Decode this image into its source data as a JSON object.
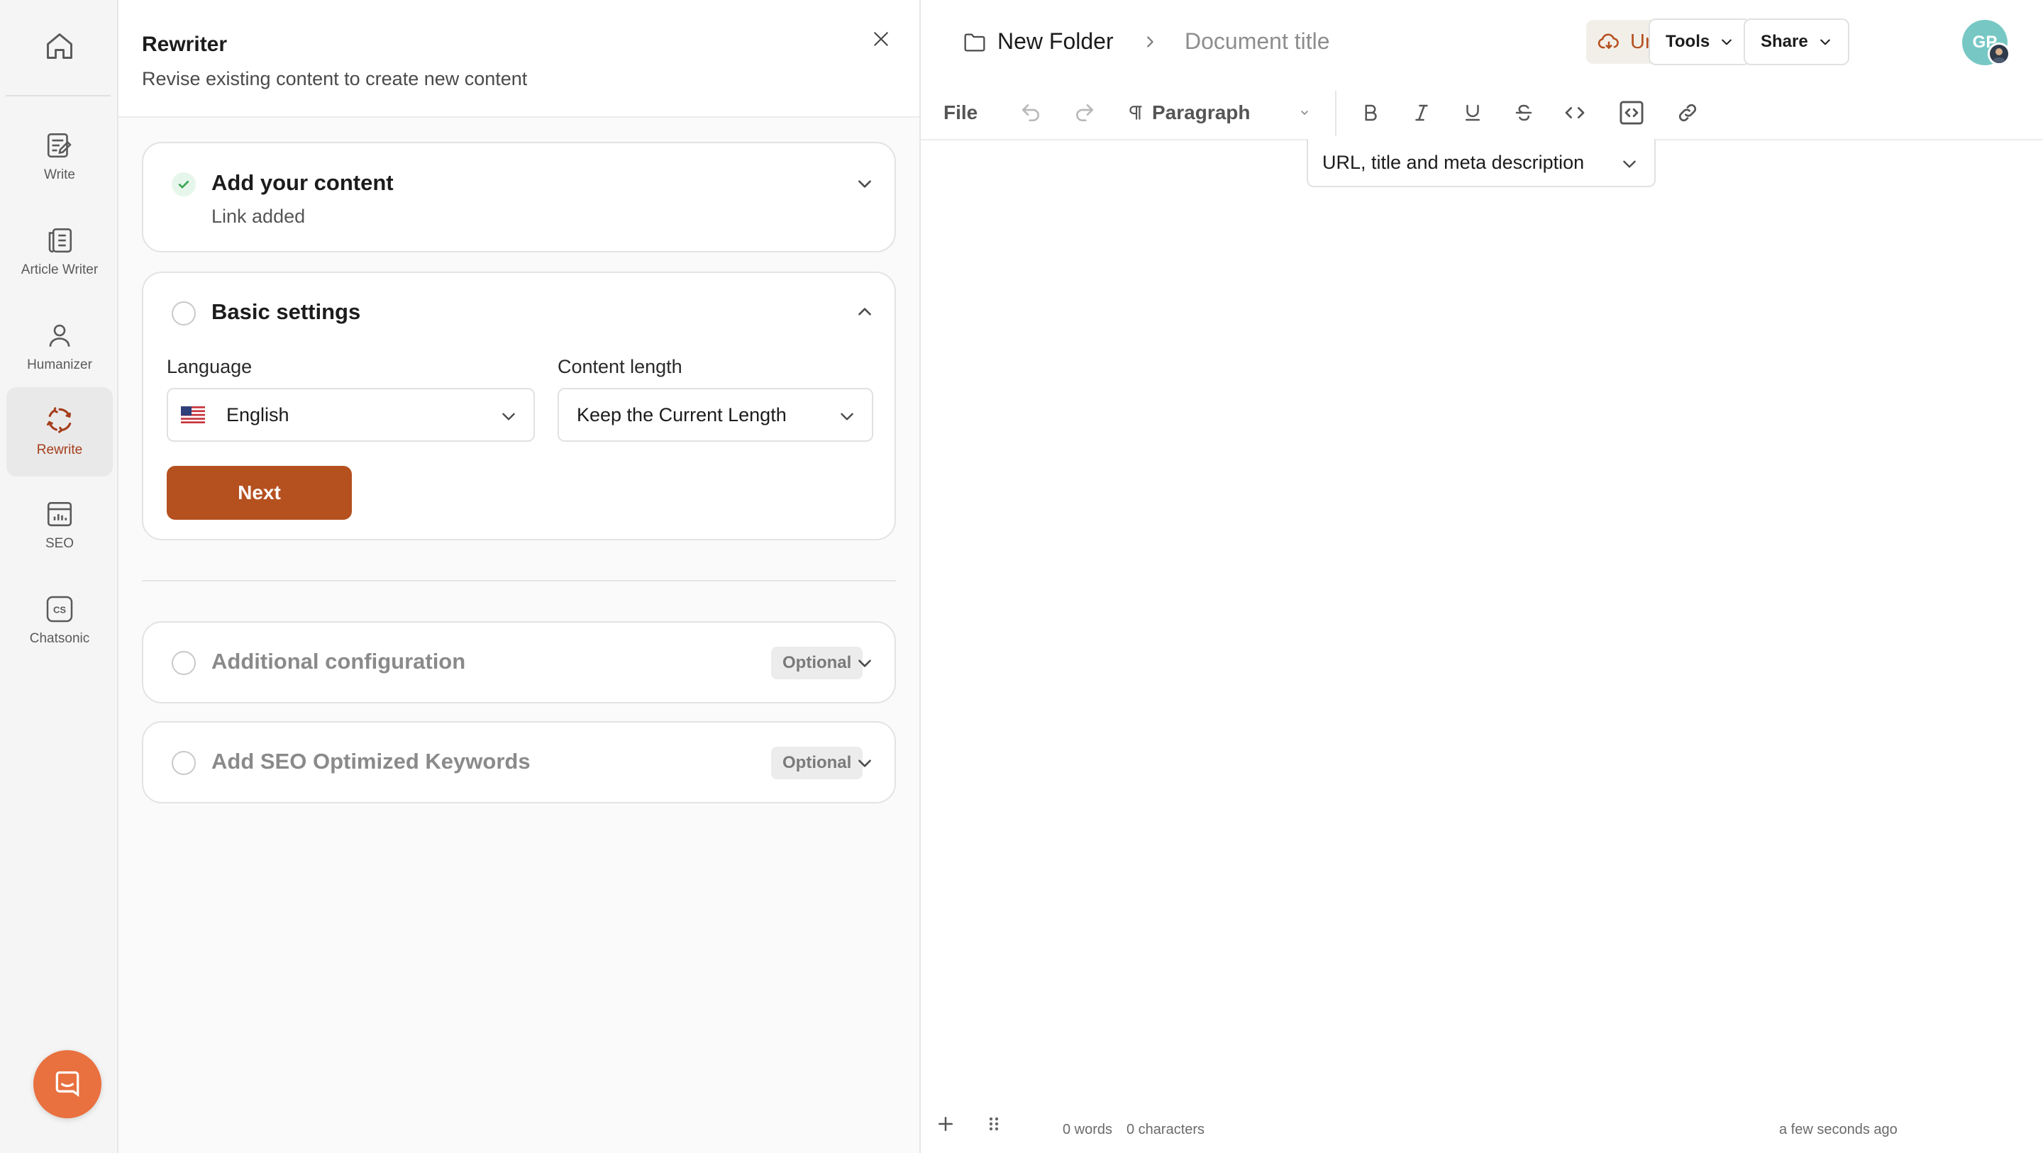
{
  "rail": {
    "items": [
      {
        "label": "Write",
        "icon": "write-icon"
      },
      {
        "label": "Article Writer",
        "icon": "article-writer-icon"
      },
      {
        "label": "Humanizer",
        "icon": "person-icon"
      },
      {
        "label": "Rewrite",
        "icon": "rewrite-icon",
        "active": true
      },
      {
        "label": "SEO",
        "icon": "seo-icon"
      },
      {
        "label": "Chatsonic",
        "icon": "chatsonic-icon"
      }
    ],
    "chatsonic_badge": "CS"
  },
  "panel": {
    "title": "Rewriter",
    "subtitle": "Revise existing content to create new content",
    "step1": {
      "title": "Add your content",
      "status": "Link added"
    },
    "step2": {
      "title": "Basic settings",
      "language_label": "Language",
      "language_value": "English",
      "length_label": "Content length",
      "length_value": "Keep the Current Length",
      "next_label": "Next"
    },
    "step3": {
      "title": "Additional configuration",
      "badge": "Optional"
    },
    "step4": {
      "title": "Add SEO Optimized Keywords",
      "badge": "Optional"
    }
  },
  "editor": {
    "breadcrumb": {
      "folder": "New Folder",
      "document": "Document title"
    },
    "unsaved_label": "Unsaved",
    "tools_label": "Tools",
    "share_label": "Share",
    "avatar_initials": "GP",
    "toolbar": {
      "file_label": "File",
      "paragraph_label": "Paragraph"
    },
    "meta_dropdown_label": "URL, title and meta description",
    "footer": {
      "words": "0 words",
      "characters": "0 characters",
      "saved": "a few seconds ago"
    }
  },
  "colors": {
    "accent": "#b5501f",
    "chat_bubble": "#e9703f",
    "avatar": "#77c8c4",
    "check_green": "#3aa657"
  }
}
